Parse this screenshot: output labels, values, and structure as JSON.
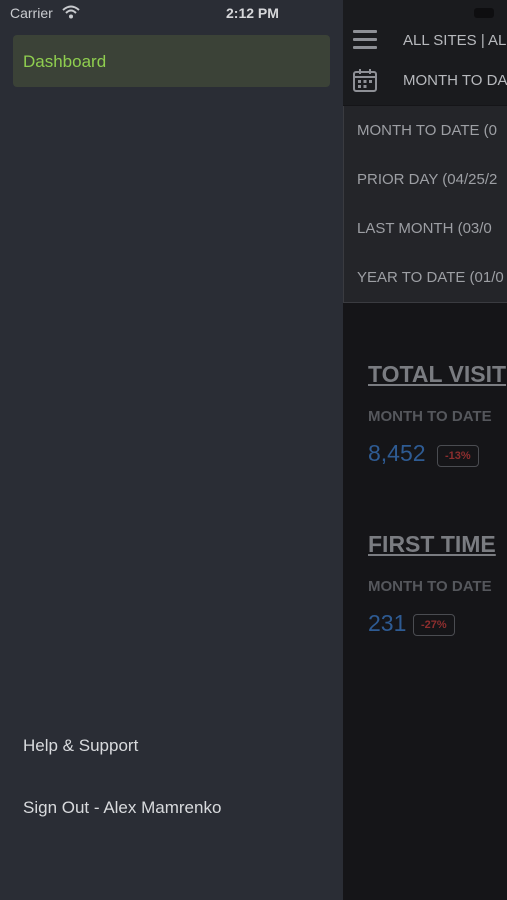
{
  "status_bar": {
    "carrier": "Carrier",
    "time": "2:12 PM"
  },
  "drawer": {
    "active_item": "Dashboard",
    "links": [
      "Help & Support",
      "Sign Out - Alex Mamrenko"
    ]
  },
  "header": {
    "site_title": "ALL SITES | AL",
    "range_label": "MONTH TO DA"
  },
  "dropdown": {
    "options": [
      "MONTH TO DATE (0",
      "PRIOR DAY (04/25/2",
      "LAST MONTH (03/0",
      "YEAR TO DATE (01/0"
    ]
  },
  "metrics": [
    {
      "title": "TOTAL VISIT",
      "period": "MONTH TO DATE",
      "value": "8,452",
      "change": "-13%"
    },
    {
      "title": "FIRST TIME ",
      "period": "MONTH TO DATE",
      "value": "231",
      "change": "-27%"
    }
  ],
  "colors": {
    "accent": "#8fce4f",
    "drawer_bg": "#2a2d35",
    "value_blue": "#2e5b93",
    "negative": "#8e2e2e"
  },
  "icons": {
    "wifi": "wifi-icon",
    "battery": "battery-icon",
    "menu": "menu-icon",
    "calendar": "calendar-icon"
  }
}
